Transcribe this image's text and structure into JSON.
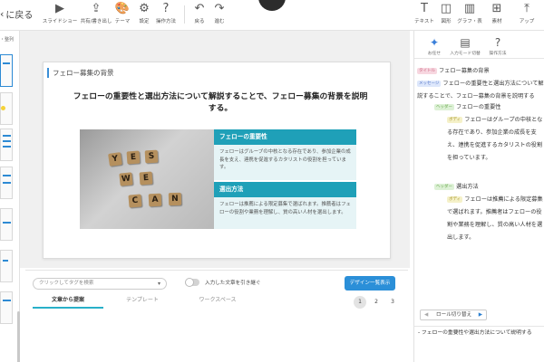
{
  "topbar": {
    "back_label": "に戻る",
    "tools_left": [
      {
        "icon": "play-icon",
        "glyph": "▶",
        "label": "スライドショー"
      },
      {
        "icon": "share-icon",
        "glyph": "⇪",
        "label": "共有/書き出し"
      },
      {
        "icon": "palette-icon",
        "glyph": "🎨",
        "label": "テーマ"
      },
      {
        "icon": "gear-icon",
        "glyph": "⚙",
        "label": "設定"
      },
      {
        "icon": "help-icon",
        "glyph": "?",
        "label": "操作方法"
      },
      {
        "icon": "undo-icon",
        "glyph": "↶",
        "label": "戻る"
      },
      {
        "icon": "redo-icon",
        "glyph": "↷",
        "label": "進む"
      }
    ],
    "tools_right": [
      {
        "icon": "text-icon",
        "glyph": "T",
        "label": "テキスト"
      },
      {
        "icon": "shape-icon",
        "glyph": "◫",
        "label": "図形"
      },
      {
        "icon": "chart-icon",
        "glyph": "▥",
        "label": "グラフ・表"
      },
      {
        "icon": "material-icon",
        "glyph": "⊞",
        "label": "素材"
      },
      {
        "icon": "upload-icon",
        "glyph": "⤒",
        "label": "アップ"
      }
    ]
  },
  "leftbar": {
    "section_label": "・整列"
  },
  "slide": {
    "title": "フェロー募集の背景",
    "heading": "フェローの重要性と選出方法について解説することで、フェロー募集の背景を説明する。",
    "photo_tiles": [
      "Y",
      "E",
      "S",
      "W",
      "E",
      "C",
      "A",
      "N"
    ],
    "cards": [
      {
        "head": "フェローの重要性",
        "body": "フェローはグループの中核となる存在であり、参加企業の成長を支え、連携を促進するカタリストの役割を担っています。"
      },
      {
        "head": "選出方法",
        "body": "フェローは推薦による限定募集で選ばれます。推薦者はフェローの役割や業務を理解し、質の高い人材を選出します。"
      }
    ]
  },
  "bottom": {
    "tag_placeholder": "クリックしてタグを検索",
    "toggle_label": "入力した文章を引き継ぐ",
    "design_button": "デザイン一覧表示",
    "tabs": [
      "文章から提案",
      "テンプレート",
      "ワークスペース"
    ],
    "pages": [
      "1",
      "2",
      "3"
    ],
    "current_page": "1"
  },
  "right": {
    "tools": [
      {
        "icon": "sparkle-icon",
        "glyph": "✦",
        "label": "お任せ"
      },
      {
        "icon": "input-mode-icon",
        "glyph": "▤",
        "label": "入力モード切替"
      },
      {
        "icon": "help-icon",
        "glyph": "?",
        "label": "操作方法"
      }
    ],
    "outline": [
      {
        "tag": "タイトル",
        "kind": "title",
        "text": "フェロー募集の背景"
      },
      {
        "tag": "メッセージ",
        "kind": "msg",
        "text": "フェローの重要性と選出方法について解説することで、フェロー募集の背景を説明する"
      },
      {
        "tag": "ヘッダー",
        "kind": "head",
        "text": "フェローの重要性"
      },
      {
        "tag": "ボディ",
        "kind": "body",
        "text": "フェローはグループの中核となる存在であり、参加企業の成長を支え、連携を促進するカタリストの役割を担っています。"
      },
      {
        "tag": "ヘッダー",
        "kind": "head",
        "text": "選出方法"
      },
      {
        "tag": "ボディ",
        "kind": "body",
        "text": "フェローは推薦による限定募集で選ばれます。推薦者はフェローの役割や業務を理解し、質の高い人材を選出します。"
      }
    ],
    "role_switch": "ロール切り替え",
    "input_text": "- フェローの重要性や選出方法について説明する"
  }
}
